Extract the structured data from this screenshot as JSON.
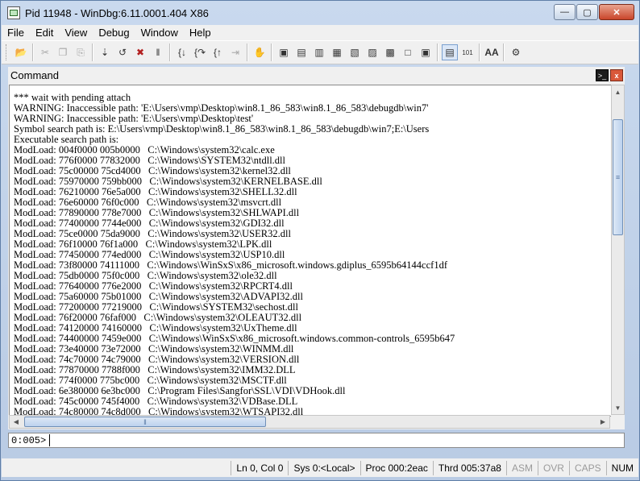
{
  "window": {
    "title": "Pid 11948 - WinDbg:6.11.0001.404 X86",
    "buttons": {
      "minimize": "—",
      "maximize": "▢",
      "close": "✕"
    }
  },
  "menu": [
    "File",
    "Edit",
    "View",
    "Debug",
    "Window",
    "Help"
  ],
  "toolbar": {
    "icons": [
      "open-icon",
      "cut-icon",
      "copy-icon",
      "paste-icon",
      "go-icon",
      "restart-icon",
      "stop-debugging-icon",
      "break-icon",
      "step-into-icon",
      "step-over-icon",
      "step-out-icon",
      "run-to-cursor-icon",
      "breakpoint-hand-icon",
      "command-window-icon",
      "watch-icon",
      "locals-icon",
      "registers-icon",
      "memory-icon",
      "call-stack-icon",
      "disassembly-icon",
      "scratch-pad-icon",
      "source-mode-icon",
      "hex-mode-icon",
      "font-icon",
      "options-icon"
    ],
    "labels": {
      "source_mode": "▤",
      "hex_mode": "101",
      "font": "AA",
      "font_small": "A",
      "options": "⚙"
    }
  },
  "pane": {
    "title": "Command",
    "console_icon": ">_",
    "close_icon": "x"
  },
  "output_lines": [
    "*** wait with pending attach",
    "WARNING: Inaccessible path: 'E:\\Users\\vmp\\Desktop\\win8.1_86_583\\win8.1_86_583\\debugdb\\win7'",
    "WARNING: Inaccessible path: 'E:\\Users\\vmp\\Desktop\\test'",
    "Symbol search path is: E:\\Users\\vmp\\Desktop\\win8.1_86_583\\win8.1_86_583\\debugdb\\win7;E:\\Users",
    "Executable search path is:",
    "ModLoad: 004f0000 005b0000   C:\\Windows\\system32\\calc.exe",
    "ModLoad: 776f0000 77832000   C:\\Windows\\SYSTEM32\\ntdll.dll",
    "ModLoad: 75c00000 75cd4000   C:\\Windows\\system32\\kernel32.dll",
    "ModLoad: 75970000 759bb000   C:\\Windows\\system32\\KERNELBASE.dll",
    "ModLoad: 76210000 76e5a000   C:\\Windows\\system32\\SHELL32.dll",
    "ModLoad: 76e60000 76f0c000   C:\\Windows\\system32\\msvcrt.dll",
    "ModLoad: 77890000 778e7000   C:\\Windows\\system32\\SHLWAPI.dll",
    "ModLoad: 77400000 7744e000   C:\\Windows\\system32\\GDI32.dll",
    "ModLoad: 75ce0000 75da9000   C:\\Windows\\system32\\USER32.dll",
    "ModLoad: 76f10000 76f1a000   C:\\Windows\\system32\\LPK.dll",
    "ModLoad: 77450000 774ed000   C:\\Windows\\system32\\USP10.dll",
    "ModLoad: 73f80000 74111000   C:\\Windows\\WinSxS\\x86_microsoft.windows.gdiplus_6595b64144ccf1df",
    "ModLoad: 75db0000 75f0c000   C:\\Windows\\system32\\ole32.dll",
    "ModLoad: 77640000 776e2000   C:\\Windows\\system32\\RPCRT4.dll",
    "ModLoad: 75a60000 75b01000   C:\\Windows\\system32\\ADVAPI32.dll",
    "ModLoad: 77200000 77219000   C:\\Windows\\SYSTEM32\\sechost.dll",
    "ModLoad: 76f20000 76faf000   C:\\Windows\\system32\\OLEAUT32.dll",
    "ModLoad: 74120000 74160000   C:\\Windows\\system32\\UxTheme.dll",
    "ModLoad: 74400000 7459e000   C:\\Windows\\WinSxS\\x86_microsoft.windows.common-controls_6595b647",
    "ModLoad: 73e40000 73e72000   C:\\Windows\\system32\\WINMM.dll",
    "ModLoad: 74c70000 74c79000   C:\\Windows\\system32\\VERSION.dll",
    "ModLoad: 77870000 7788f000   C:\\Windows\\system32\\IMM32.DLL",
    "ModLoad: 774f0000 775bc000   C:\\Windows\\system32\\MSCTF.dll",
    "ModLoad: 6e380000 6e3bc000   C:\\Program Files\\Sangfor\\SSL\\VDI\\VDHook.dll",
    "ModLoad: 745c0000 745f4000   C:\\Windows\\system32\\VDBase.DLL",
    "ModLoad: 74c80000 74c8d000   C:\\Windows\\system32\\WTSAPI32.dll"
  ],
  "command": {
    "prompt": "0:005>",
    "value": ""
  },
  "status": {
    "position": "Ln 0, Col 0",
    "sys": "Sys 0:<Local>",
    "proc": "Proc 000:2eac",
    "thread": "Thrd 005:37a8",
    "asm": "ASM",
    "ovr": "OVR",
    "caps": "CAPS",
    "num": "NUM"
  }
}
